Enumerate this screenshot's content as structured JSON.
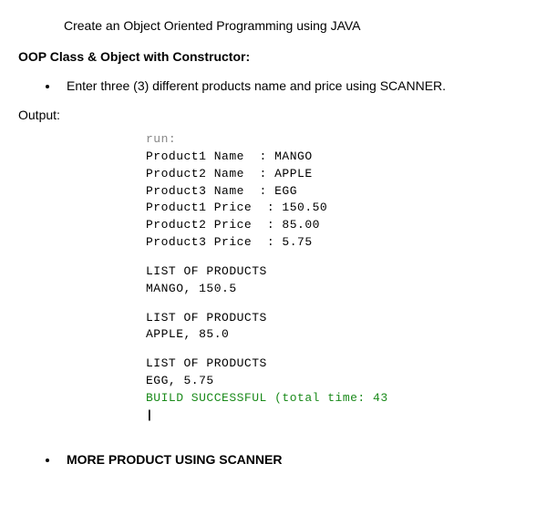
{
  "title": "Create an Object Oriented Programming using JAVA",
  "section_heading": "OOP Class & Object with Constructor:",
  "instruction": "Enter three (3) different products name and price using SCANNER.",
  "output_label": "Output:",
  "console": {
    "run": "run:",
    "lines": [
      "Product1 Name  : MANGO",
      "Product2 Name  : APPLE",
      "Product3 Name  : EGG",
      "Product1 Price  : 150.50",
      "Product2 Price  : 85.00",
      "Product3 Price  : 5.75"
    ],
    "list_header": "LIST OF PRODUCTS",
    "products": [
      "MANGO, 150.5",
      "APPLE, 85.0",
      "EGG, 5.75"
    ],
    "build_msg": "BUILD SUCCESSFUL (total time: 43",
    "cursor": "|"
  },
  "more_product": "MORE PRODUCT USING SCANNER"
}
